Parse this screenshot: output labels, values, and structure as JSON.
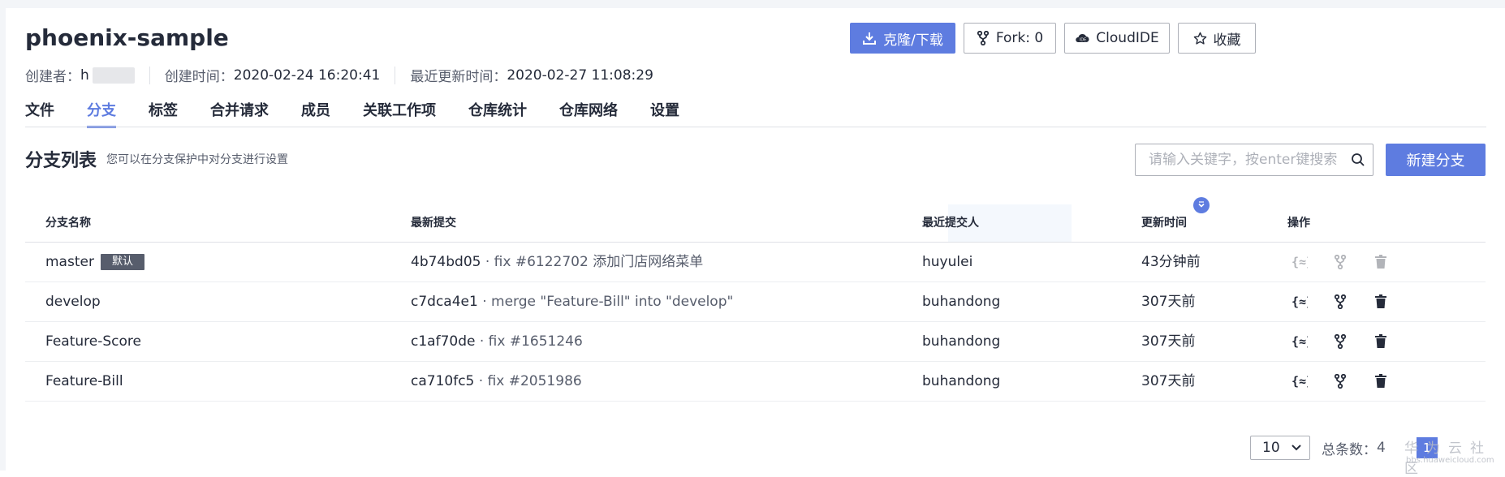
{
  "repo": {
    "name": "phoenix-sample",
    "creator_label": "创建者：",
    "creator_value": "h",
    "created_label": "创建时间：",
    "created_value": "2020-02-24 16:20:41",
    "updated_label": "最近更新时间：",
    "updated_value": "2020-02-27 11:08:29"
  },
  "actions": {
    "clone_label": "克隆/下载",
    "fork_label": "Fork: 0",
    "cloudide_label": "CloudIDE",
    "favorite_label": "收藏"
  },
  "tabs": [
    {
      "label": "文件",
      "active": false
    },
    {
      "label": "分支",
      "active": true
    },
    {
      "label": "标签",
      "active": false
    },
    {
      "label": "合并请求",
      "active": false
    },
    {
      "label": "成员",
      "active": false
    },
    {
      "label": "关联工作项",
      "active": false
    },
    {
      "label": "仓库统计",
      "active": false
    },
    {
      "label": "仓库网络",
      "active": false
    },
    {
      "label": "设置",
      "active": false
    }
  ],
  "section": {
    "title": "分支列表",
    "description": "您可以在分支保护中对分支进行设置",
    "search_placeholder": "请输入关键字，按enter键搜索",
    "new_branch_label": "新建分支"
  },
  "table": {
    "headers": {
      "name": "分支名称",
      "commit": "最新提交",
      "committer": "最近提交人",
      "updated": "更新时间",
      "ops": "操作"
    },
    "rows": [
      {
        "name": "master",
        "badge": "默认",
        "hash": "4b74bd05",
        "message": " · fix #6122702 添加门店网络菜单",
        "committer": "huyulei",
        "updated": "43分钟前",
        "protected": true
      },
      {
        "name": "develop",
        "badge": "",
        "hash": "c7dca4e1",
        "message": " · merge \"Feature-Bill\" into \"develop\"",
        "committer": "buhandong",
        "updated": "307天前",
        "protected": false
      },
      {
        "name": "Feature-Score",
        "badge": "",
        "hash": "c1af70de",
        "message": " · fix #1651246",
        "committer": "buhandong",
        "updated": "307天前",
        "protected": false
      },
      {
        "name": "Feature-Bill",
        "badge": "",
        "hash": "ca710fc5",
        "message": " · fix #2051986",
        "committer": "buhandong",
        "updated": "307天前",
        "protected": false
      }
    ]
  },
  "pagination": {
    "page_size": "10",
    "total_label": "总条数：",
    "total_value": "4",
    "current_page": "1"
  },
  "watermark": {
    "text": "华为云社区",
    "url": "bbs.huaweicloud.com"
  },
  "colors": {
    "accent": "#5e7ce0",
    "text": "#252b3a",
    "muted": "#575d6c",
    "border": "#dfe1e6"
  }
}
